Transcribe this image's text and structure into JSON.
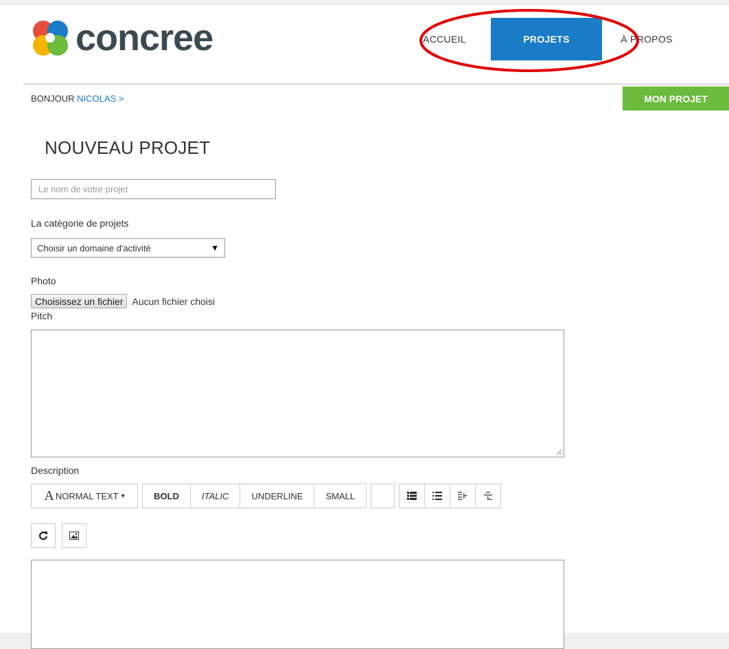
{
  "app": {
    "name": "concree",
    "brand_color": "#1a7bc7",
    "accent_green": "#6cbb3c"
  },
  "nav": {
    "items": [
      {
        "label": "ACCUEIL",
        "active": false
      },
      {
        "label": "PROJETS",
        "active": true
      },
      {
        "label": "À PROPOS",
        "active": false
      }
    ]
  },
  "annotation": {
    "shape": "ellipse",
    "color": "#e00000",
    "highlights": "PROJETS"
  },
  "greeting": {
    "prefix": "BONJOUR ",
    "user": "NICOLAS",
    "chevron": ">"
  },
  "my_project_button": "MON PROJET",
  "form": {
    "title": "NOUVEAU PROJET",
    "name_placeholder": "Le nom de votre projet",
    "category_label": "La catégorie de projets",
    "category_value": "Choisir un domaine d'activité",
    "category_arrow": "▼",
    "photo_label": "Photo",
    "file_button": "Choisissez un fichier",
    "file_status": "Aucun fichier choisi",
    "pitch_label": "Pitch",
    "description_label": "Description"
  },
  "editor_toolbar": {
    "normal_text_glyph": "A",
    "normal_text": "NORMAL TEXT",
    "normal_text_caret": "▾",
    "bold": "BOLD",
    "italic": "ITALIC",
    "underline": "UNDERLINE",
    "small": "SMALL",
    "list_icons": [
      "unordered-list-icon",
      "ordered-list-icon",
      "outdent-icon",
      "indent-icon"
    ],
    "row2_icons": [
      "undo-icon",
      "image-icon"
    ]
  }
}
